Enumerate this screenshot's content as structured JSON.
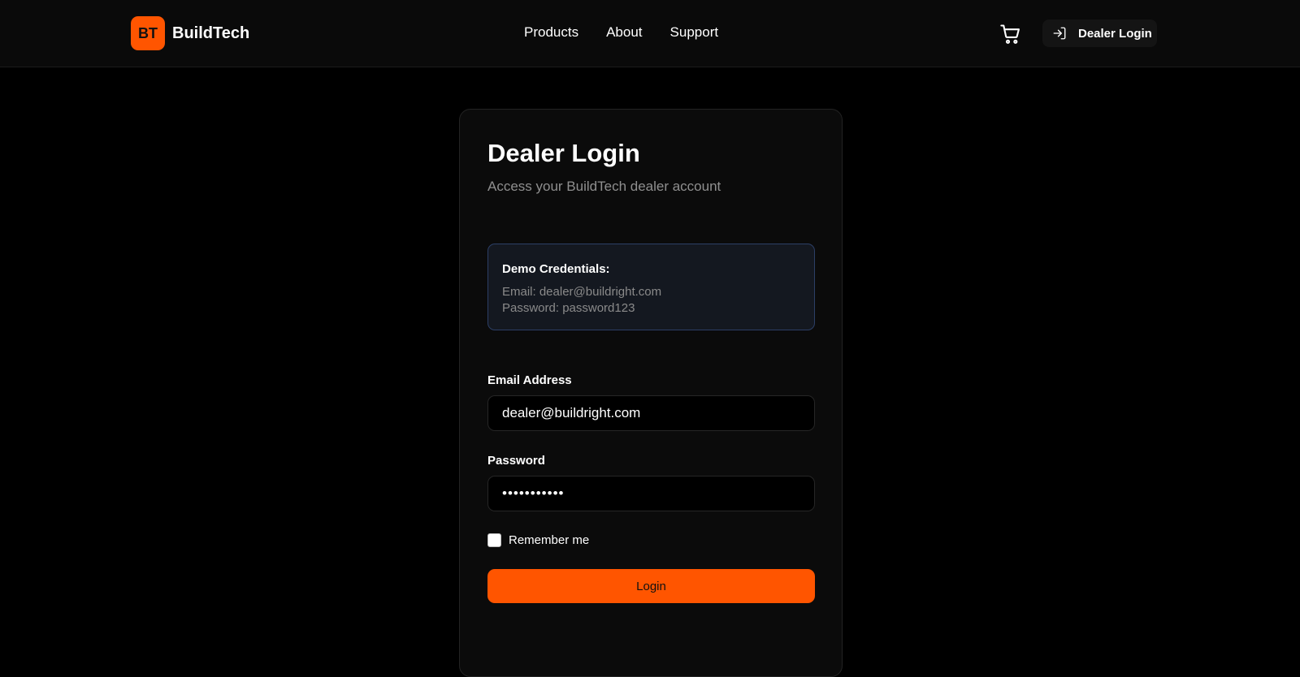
{
  "header": {
    "logo_mark": "BT",
    "brand_name": "BuildTech",
    "nav": [
      {
        "label": "Products"
      },
      {
        "label": "About"
      },
      {
        "label": "Support"
      }
    ],
    "cart_icon": "shopping-cart-icon",
    "dealer_login_label": "Dealer Login",
    "dealer_login_icon": "login-arrow-icon"
  },
  "login_card": {
    "title": "Dealer Login",
    "subtitle": "Access your BuildTech dealer account",
    "demo": {
      "title": "Demo Credentials:",
      "email_line": "Email: dealer@buildright.com",
      "password_line": "Password: password123"
    },
    "email_label": "Email Address",
    "email_value": "dealer@buildright.com",
    "password_label": "Password",
    "password_value": "password123",
    "remember_label": "Remember me",
    "login_button_label": "Login"
  },
  "colors": {
    "accent": "#ff5500",
    "background": "#000000",
    "card": "#0b0b0b",
    "demo_border": "#2c3f66"
  }
}
